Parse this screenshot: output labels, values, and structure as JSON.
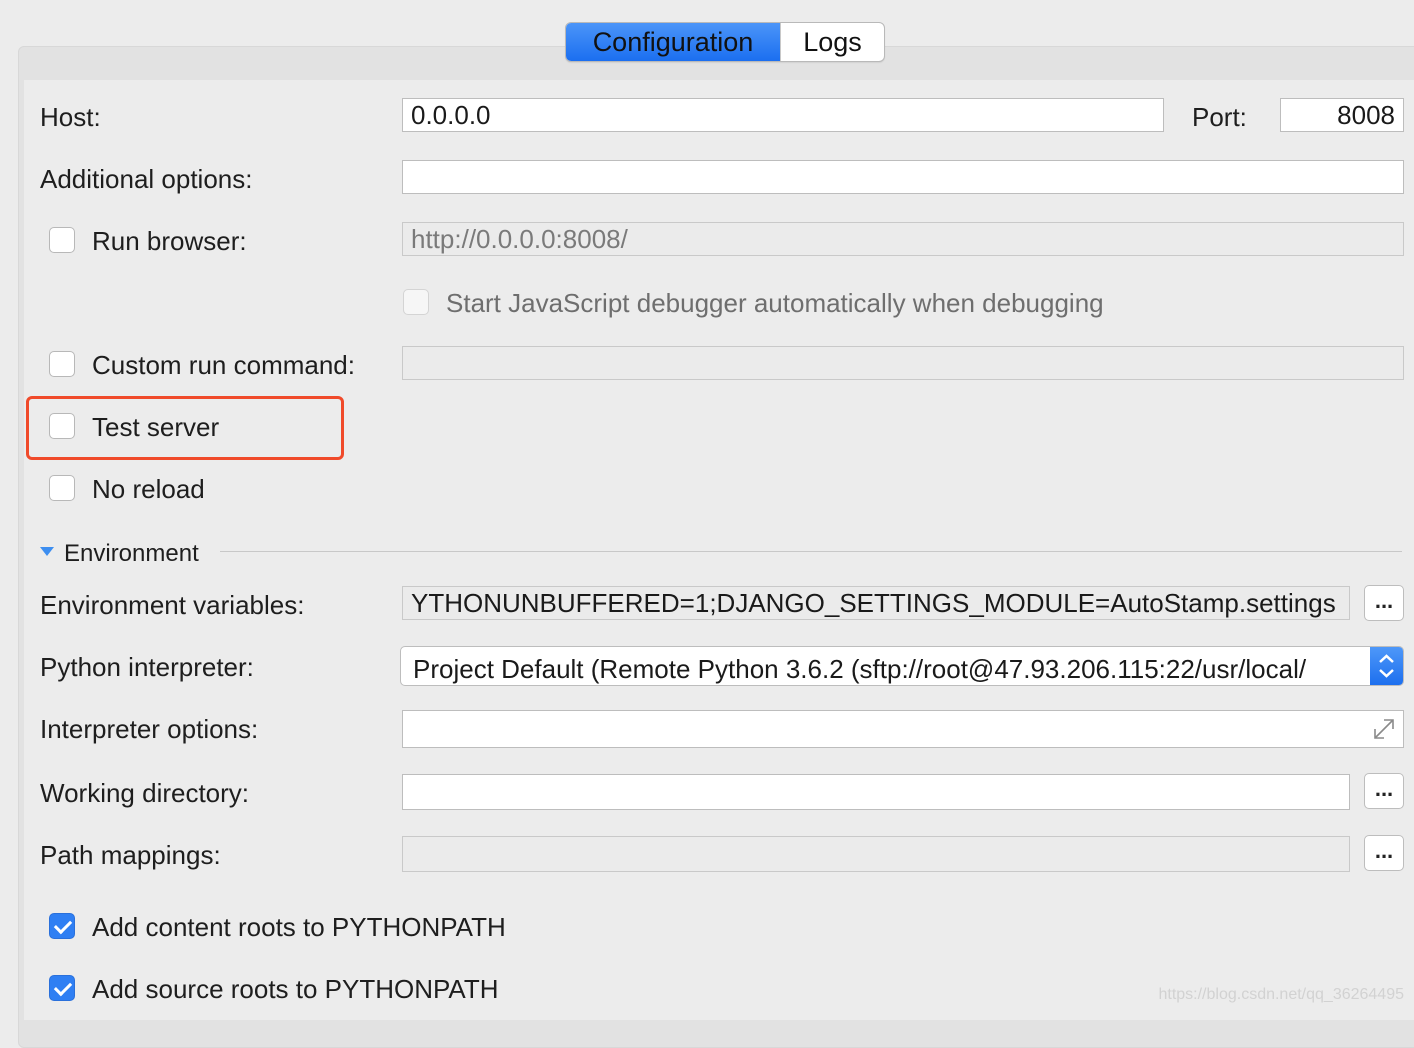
{
  "tabs": {
    "configuration": "Configuration",
    "logs": "Logs"
  },
  "host": {
    "label": "Host:",
    "value": "0.0.0.0"
  },
  "port": {
    "label": "Port:",
    "value": "8008"
  },
  "additional_options": {
    "label": "Additional options:",
    "value": ""
  },
  "run_browser": {
    "label": "Run browser:",
    "checked": false,
    "url": "http://0.0.0.0:8008/"
  },
  "js_debugger": {
    "label": "Start JavaScript debugger automatically when debugging",
    "checked": false,
    "disabled": true
  },
  "custom_run_command": {
    "label": "Custom run command:",
    "checked": false,
    "value": ""
  },
  "test_server": {
    "label": "Test server",
    "checked": false
  },
  "no_reload": {
    "label": "No reload",
    "checked": false
  },
  "environment": {
    "section_title": "Environment",
    "env_vars_label": "Environment variables:",
    "env_vars_value": "YTHONUNBUFFERED=1;DJANGO_SETTINGS_MODULE=AutoStamp.settings",
    "interpreter_label": "Python interpreter:",
    "interpreter_value": "Project Default (Remote Python 3.6.2 (sftp://root@47.93.206.115:22/usr/local/",
    "interpreter_options_label": "Interpreter options:",
    "interpreter_options_value": "",
    "working_dir_label": "Working directory:",
    "working_dir_value": "",
    "path_mappings_label": "Path mappings:",
    "path_mappings_value": ""
  },
  "browse_button_label": "...",
  "content_roots": {
    "label": "Add content roots to PYTHONPATH",
    "checked": true
  },
  "source_roots": {
    "label": "Add source roots to PYTHONPATH",
    "checked": true
  },
  "watermark": "https://blog.csdn.net/qq_36264495",
  "colors": {
    "accent": "#1b6ff0",
    "highlight_border": "#f04a2a"
  }
}
